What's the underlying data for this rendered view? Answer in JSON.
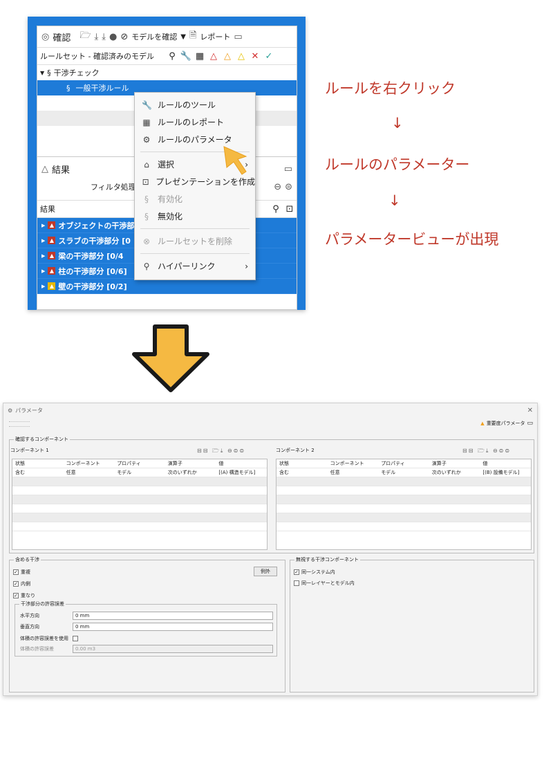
{
  "confirm_panel": {
    "title": "確認",
    "check_model_button": "モデルを確認",
    "report_button": "レポート",
    "column_header": "ルールセット - 確認済みのモデル",
    "tree": {
      "group": "干渉チェック",
      "rule": "一般干渉ルール"
    }
  },
  "context_menu": {
    "items": [
      {
        "icon": "wrench-icon",
        "label": "ルールのツール"
      },
      {
        "icon": "table-icon",
        "label": "ルールのレポート"
      },
      {
        "icon": "gear-icon",
        "label": "ルールのパラメータ"
      },
      {
        "icon": "select-icon",
        "label": "選択"
      },
      {
        "icon": "presentation-icon",
        "label": "プレゼンテーションを作成"
      },
      {
        "icon": "section-icon",
        "label": "有効化"
      },
      {
        "icon": "section-icon",
        "label": "無効化"
      },
      {
        "icon": "delete-icon",
        "label": "ルールセットを削除"
      },
      {
        "icon": "link-icon",
        "label": "ハイパーリンク"
      }
    ]
  },
  "result_panel": {
    "title": "結果",
    "filter_label": "フィルタ処理な",
    "column_header": "結果",
    "items": [
      "オブジェクトの干渉部",
      "スラブの干渉部分 [0",
      "梁の干渉部分 [0/4",
      "柱の干渉部分 [0/6]",
      "壁の干渉部分 [0/2]"
    ]
  },
  "annotations": {
    "step1": "ルールを右クリック",
    "arrow": "↓",
    "step2": "ルールのパラメーター",
    "step3": "パラメータービューが出現"
  },
  "dialog": {
    "title": "パラメータ",
    "severity_label": "重要度パラメータ",
    "components_group": "確認するコンポーネント",
    "component1_label": "コンポーネント 1",
    "component2_label": "コンポーネント 2",
    "table_headers": [
      "状態",
      "コンポーネント",
      "プロパティ",
      "演算子",
      "値"
    ],
    "component1_row": [
      "含む",
      "任意",
      "モデル",
      "次のいずれか",
      "[(A) 構造モデル]"
    ],
    "component2_row": [
      "含む",
      "任意",
      "モデル",
      "次のいずれか",
      "[(B) 設備モデル]"
    ],
    "include_group": "含める干渉",
    "exception_button": "例外",
    "include_options": [
      "重複",
      "内側",
      "重なり"
    ],
    "tolerance_group": "干渉部分の許容誤差",
    "horizontal_label": "水平方向",
    "horizontal_value": "0 mm",
    "vertical_label": "垂直方向",
    "vertical_value": "0 mm",
    "use_volume_label": "体積の許容誤差を使用",
    "volume_label": "体積の許容誤差",
    "volume_value": "0.00 m3",
    "ignore_group": "無視する干渉コンポーネント",
    "ignore_options": [
      "同一システム内",
      "同一レイヤーとモデル内"
    ]
  }
}
